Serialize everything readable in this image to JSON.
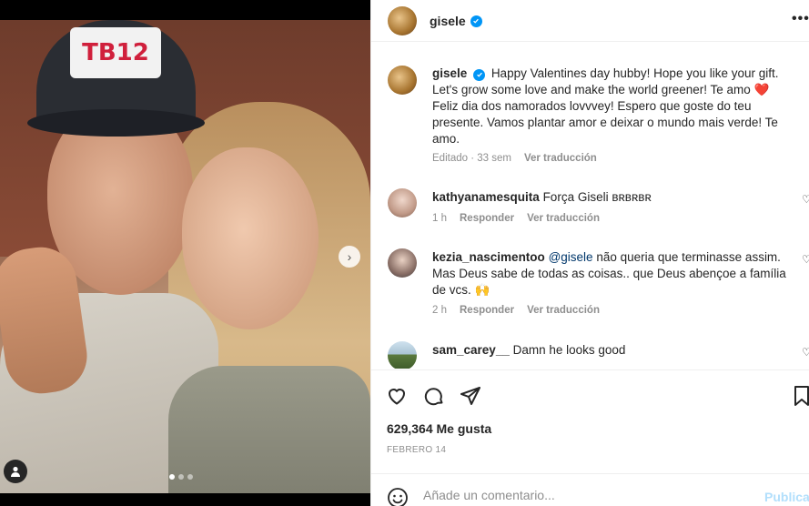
{
  "post": {
    "username": "gisele",
    "verified": true,
    "caption": "Happy Valentines day hubby! Hope you like your gift. Let's grow some love and make the world greener! Te amo ❤️ Feliz dia dos namorados lovvvey! Espero que goste do teu presente. Vamos plantar amor e deixar o mundo mais verde! Te amo.",
    "caption_meta": {
      "edited": "Editado · 33 sem",
      "translate": "Ver traducción"
    },
    "photo": {
      "cap_text": "TB12",
      "carousel_count": 3,
      "carousel_active": 0
    }
  },
  "comments": [
    {
      "username": "kathyanamesquita",
      "text": "Força Giseli ʙʀʙʀʙʀ",
      "time": "1 h",
      "reply": "Responder",
      "translate": "Ver traducción"
    },
    {
      "username": "kezia_nascimentoo",
      "mention": "@gisele",
      "text": "não queria que terminasse assim. Mas Deus sabe de todas as coisas.. que Deus abençoe a família de vcs. 🙌",
      "time": "2 h",
      "reply": "Responder",
      "translate": "Ver traducción"
    },
    {
      "username": "sam_carey__",
      "text": "Damn he looks good"
    }
  ],
  "actions": {
    "likes": "629,364 Me gusta",
    "date": "FEBRERO 14"
  },
  "comment_box": {
    "placeholder": "Añade un comentario...",
    "post_label": "Publicar"
  },
  "colors": {
    "verified": "#0095f6",
    "post_button_disabled": "#b2dffc",
    "mention": "#00376b",
    "meta_text": "#8e8e8e"
  },
  "icons": [
    "more-options-icon",
    "verified-icon",
    "heart-icon",
    "comment-icon",
    "share-icon",
    "bookmark-icon",
    "emoji-icon",
    "chevron-right-icon",
    "user-tag-icon"
  ]
}
